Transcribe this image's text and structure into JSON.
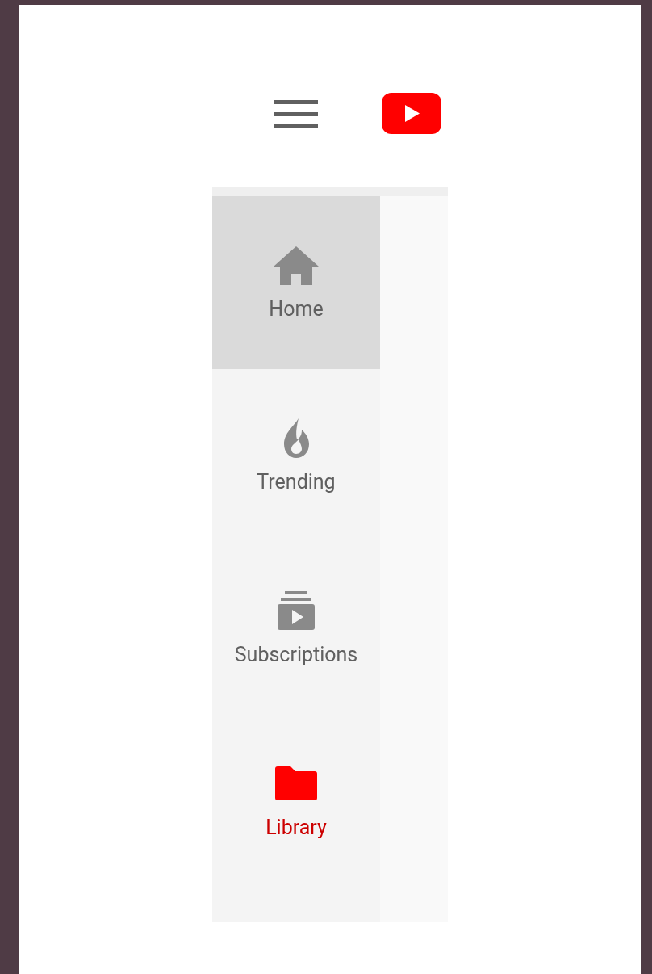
{
  "nav_items": [
    {
      "label": "Home",
      "kind": "home",
      "selected": true,
      "color": "#606060"
    },
    {
      "label": "Trending",
      "kind": "trending",
      "selected": false,
      "color": "#606060"
    },
    {
      "label": "Subscriptions",
      "kind": "subscriptions",
      "selected": false,
      "color": "#606060"
    },
    {
      "label": "Library",
      "kind": "library",
      "selected": false,
      "color": "#cc0000"
    }
  ]
}
